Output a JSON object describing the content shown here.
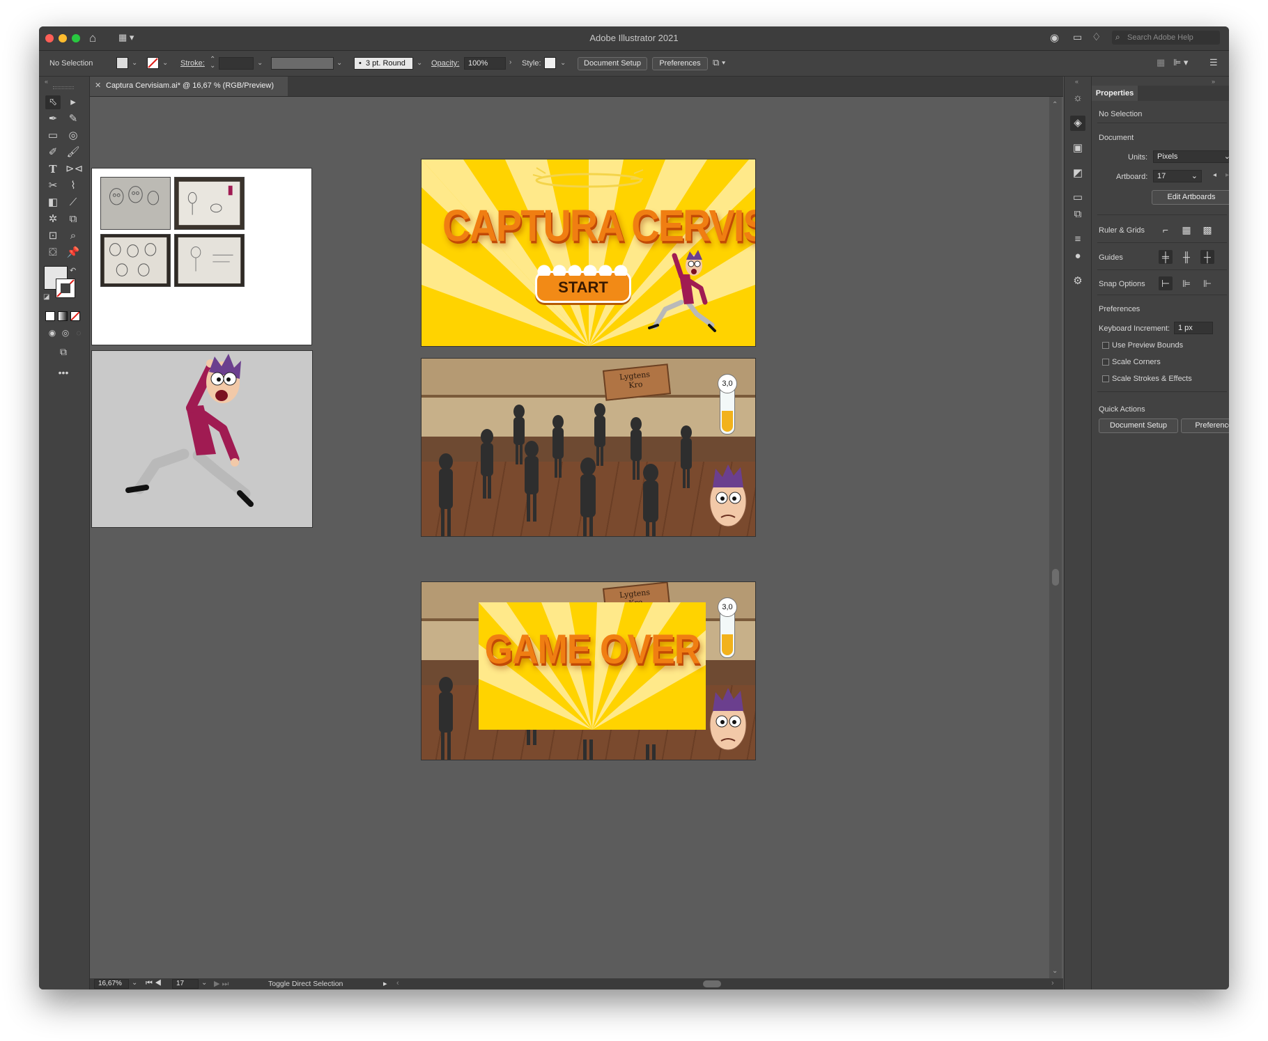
{
  "app": {
    "title": "Adobe Illustrator 2021"
  },
  "titlebar": {
    "search_placeholder": "Search Adobe Help"
  },
  "control_bar": {
    "selection_label": "No Selection",
    "stroke_label": "Stroke:",
    "stroke_profile": "3 pt. Round",
    "opacity_label": "Opacity:",
    "opacity_value": "100%",
    "style_label": "Style:",
    "document_setup": "Document Setup",
    "preferences": "Preferences"
  },
  "document_tab": {
    "title": "Captura Cervisiam.ai* @ 16,67 % (RGB/Preview)"
  },
  "status_bar": {
    "zoom": "16,67%",
    "artboard": "17",
    "tool_hint": "Toggle Direct Selection"
  },
  "properties": {
    "tab": "Properties",
    "selection": "No Selection",
    "document_header": "Document",
    "units_label": "Units:",
    "units_value": "Pixels",
    "artboard_label": "Artboard:",
    "artboard_value": "17",
    "edit_artboards": "Edit Artboards",
    "ruler_grids": "Ruler & Grids",
    "guides": "Guides",
    "snap_options": "Snap Options",
    "preferences_header": "Preferences",
    "keyboard_increment_label": "Keyboard Increment:",
    "keyboard_increment_value": "1 px",
    "checkboxes": [
      "Use Preview Bounds",
      "Scale Corners",
      "Scale Strokes & Effects"
    ],
    "quick_actions_header": "Quick Actions",
    "qa_document_setup": "Document Setup",
    "qa_preferences": "Preferences"
  },
  "artwork": {
    "title_screen": {
      "game_title": "CAPTURA CERVISIAM",
      "start_button": "START"
    },
    "tavern_sign": "Lygtens Kro",
    "meter_value": "3,0",
    "game_over": "GAME OVER"
  },
  "colors": {
    "yellow": "#ffd300",
    "ray": "#ffe98a",
    "orange": "#f07e12",
    "shirt": "#a01b52",
    "hair": "#6b3f8e",
    "wall": "#c7b089",
    "floor": "#7a4a2e"
  }
}
